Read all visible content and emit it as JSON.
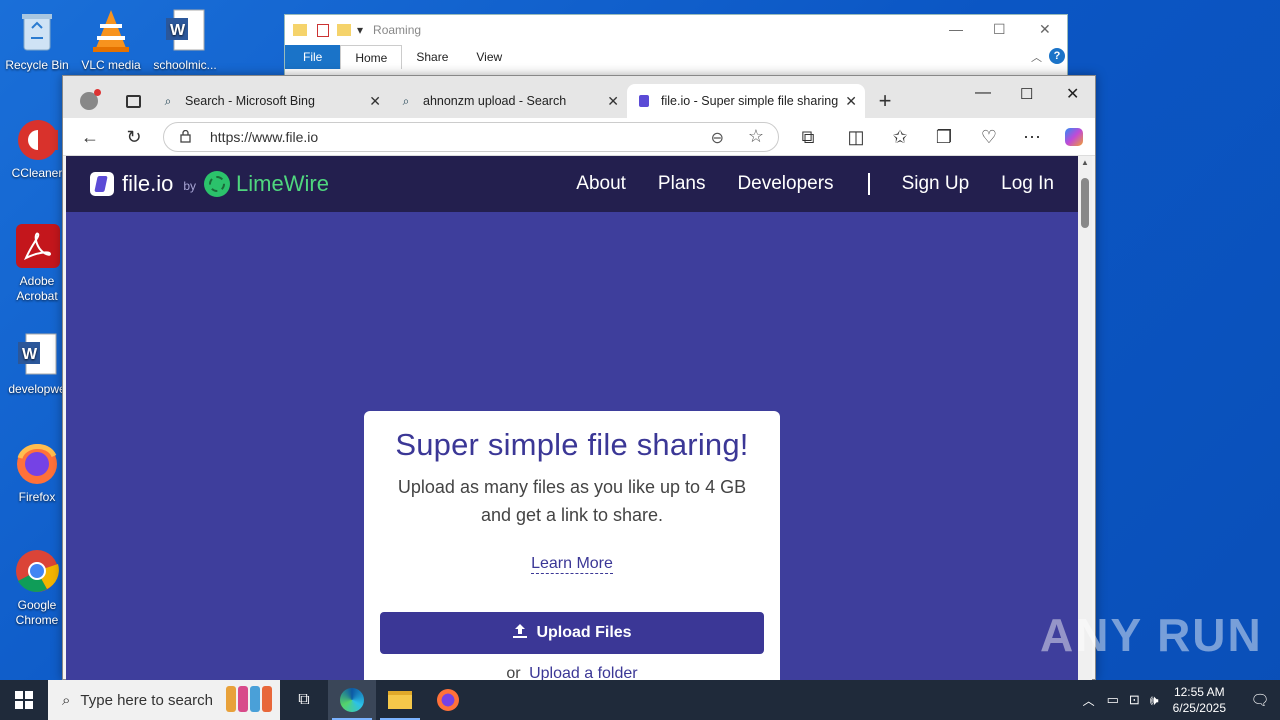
{
  "desktop": {
    "icons": [
      {
        "label": "Recycle Bin"
      },
      {
        "label": "VLC media"
      },
      {
        "label": "schoolmic..."
      },
      {
        "label": "CCleaner"
      },
      {
        "label": "Adobe Acrobat"
      },
      {
        "label": "developwe"
      },
      {
        "label": "Firefox"
      },
      {
        "label": "Google Chrome"
      }
    ]
  },
  "explorer": {
    "title": "Roaming",
    "ribbon_tabs": [
      "File",
      "Home",
      "Share",
      "View"
    ]
  },
  "browser": {
    "tabs": [
      {
        "title": "Search - Microsoft Bing"
      },
      {
        "title": "ahnonzm upload - Search"
      },
      {
        "title": "file.io - Super simple file sharing"
      }
    ],
    "url": "https://www.file.io"
  },
  "site": {
    "brand": {
      "name": "file.io",
      "by": "by",
      "partner": "LimeWire"
    },
    "nav": {
      "about": "About",
      "plans": "Plans",
      "developers": "Developers",
      "sign_up": "Sign Up",
      "log_in": "Log In"
    },
    "hero": {
      "title": "Super simple file sharing!",
      "subtitle": "Upload as many files as you like up to 4 GB and get a link to share.",
      "learn_more": "Learn More",
      "upload_button": "Upload Files",
      "or": "or",
      "upload_folder": "Upload a folder"
    }
  },
  "taskbar": {
    "search_placeholder": "Type here to search",
    "time": "12:55 AM",
    "date": "6/25/2025"
  },
  "watermark": "ANY RUN"
}
